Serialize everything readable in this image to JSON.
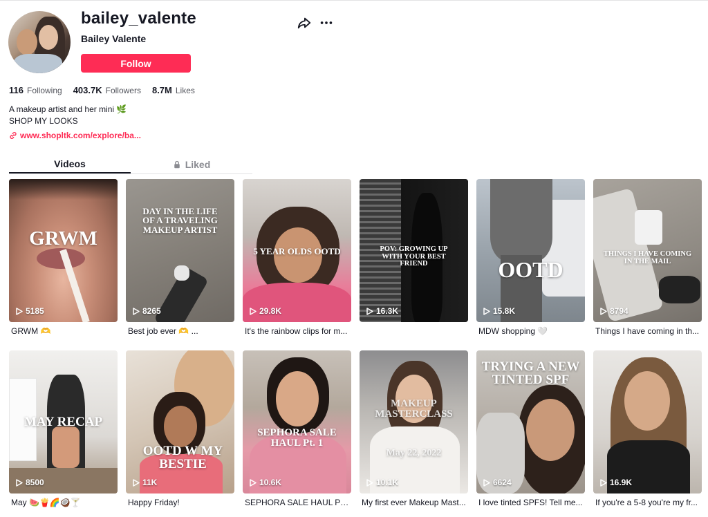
{
  "profile": {
    "username": "bailey_valente",
    "nickname": "Bailey Valente",
    "follow_label": "Follow",
    "stats": [
      {
        "value": "116",
        "label": "Following"
      },
      {
        "value": "403.7K",
        "label": "Followers"
      },
      {
        "value": "8.7M",
        "label": "Likes"
      }
    ],
    "bio_line1": "A makeup artist and her mini 🌿",
    "bio_line2": "SHOP MY LOOKS",
    "link_text": "www.shopltk.com/explore/ba...",
    "accent_color": "#fe2c55"
  },
  "tabs": [
    {
      "label": "Videos",
      "active": true
    },
    {
      "label": "Liked",
      "active": false,
      "icon": "lock-icon"
    }
  ],
  "videos": [
    {
      "overlay": "GRWM",
      "views": "5185",
      "caption": "GRWM 🫶"
    },
    {
      "overlay": "DAY IN THE LIFE OF A TRAVELING MAKEUP ARTIST",
      "views": "8265",
      "caption": "Best job ever 🫶 ..."
    },
    {
      "overlay": "5 YEAR OLDS OOTD",
      "views": "29.8K",
      "caption": "It's the rainbow clips for m..."
    },
    {
      "overlay": "POV: GROWING UP WITH YOUR BEST FRIEND",
      "views": "16.3K",
      "caption": ""
    },
    {
      "overlay": "OOTD",
      "views": "15.8K",
      "caption": "MDW shopping 🤍"
    },
    {
      "overlay": "THINGS I HAVE COMING IN THE MAIL",
      "views": "8794",
      "caption": "Things I have coming in th..."
    },
    {
      "overlay": "MAY RECAP",
      "views": "8500",
      "caption": "May 🍉🍟🌈🥥🍸"
    },
    {
      "overlay": "OOTD W MY BESTIE",
      "views": "11K",
      "caption": "Happy Friday!"
    },
    {
      "overlay": "SEPHORA SALE HAUL Pt. 1",
      "views": "10.6K",
      "caption": "SEPHORA SALE HAUL PT...."
    },
    {
      "overlay": "MAKEUP MASTERCLASS",
      "overlay2": "May 22, 2022",
      "views": "10.1K",
      "caption": "My first ever Makeup Mast..."
    },
    {
      "overlay": "TRYING A NEW TINTED SPF",
      "views": "6624",
      "caption": "I love tinted SPFS! Tell me..."
    },
    {
      "overlay": "",
      "views": "16.9K",
      "caption": "If you're a 5-8 you're my fr..."
    }
  ]
}
